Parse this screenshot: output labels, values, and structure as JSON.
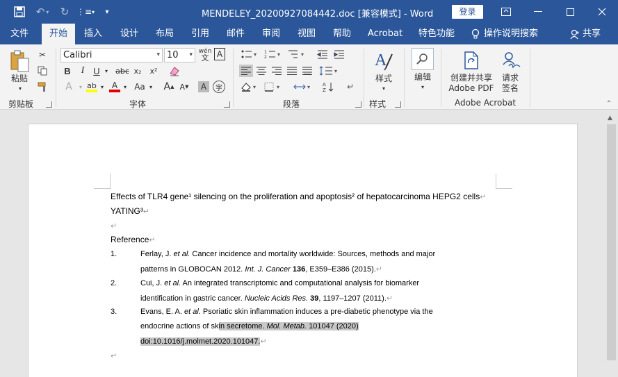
{
  "titlebar": {
    "title": "MENDELEY_20200927084442.doc [兼容模式] - Word",
    "login": "登录",
    "save_icon": "save-icon",
    "undo_icon": "undo-icon",
    "redo_icon": "redo-icon"
  },
  "tabs": [
    {
      "label": "文件"
    },
    {
      "label": "开始"
    },
    {
      "label": "插入"
    },
    {
      "label": "设计"
    },
    {
      "label": "布局"
    },
    {
      "label": "引用"
    },
    {
      "label": "邮件"
    },
    {
      "label": "审阅"
    },
    {
      "label": "视图"
    },
    {
      "label": "帮助"
    },
    {
      "label": "Acrobat"
    },
    {
      "label": "特色功能"
    }
  ],
  "tell_me": "操作说明搜索",
  "share": "共享",
  "ribbon": {
    "paste_label": "粘贴",
    "clipboard_label": "剪贴板",
    "font_name": "Calibri",
    "font_size": "10",
    "font_label": "字体",
    "paragraph_label": "段落",
    "styles_btn_label": "样式",
    "styles_label": "样式",
    "editing_label": "编辑",
    "create_pdf_line1": "创建并共享",
    "create_pdf_line2": "Adobe PDF",
    "request_sign_line1": "请求",
    "request_sign_line2": "签名",
    "acrobat_label": "Adobe Acrobat",
    "bold": "B",
    "italic": "I",
    "underline": "U",
    "strike": "abc",
    "subscript": "x₂",
    "superscript": "x²",
    "grow_font": "A",
    "shrink_font": "A",
    "change_case": "Aa",
    "wen": "wén",
    "char_border": "A"
  },
  "document": {
    "title_line": "Effects of TLR4 gene¹ silencing on the proliferation and apoptosis² of hepatocarcinoma HEPG2 cells",
    "author_line": "YATING³",
    "reference_heading": "Reference",
    "references": [
      {
        "num": "1.",
        "line1": "Ferlay, J. et al. Cancer incidence and mortality worldwide: Sources, methods and major",
        "line2": "patterns in GLOBOCAN 2012. Int. J. Cancer 136, E359–E386 (2015)."
      },
      {
        "num": "2.",
        "line1": "Cui, J. et al. An integrated transcriptomic and computational analysis for biomarker",
        "line2": "identification in gastric cancer. Nucleic Acids Res. 39, 1197–1207 (2011)."
      },
      {
        "num": "3.",
        "line1": "Evans, E. A. et al. Psoriatic skin inflammation induces a pre-diabetic phenotype via the",
        "line2": "endocrine actions of skin secretome. Mol. Metab. 101047 (2020)",
        "line3": "doi:10.1016/j.molmet.2020.101047."
      }
    ]
  }
}
